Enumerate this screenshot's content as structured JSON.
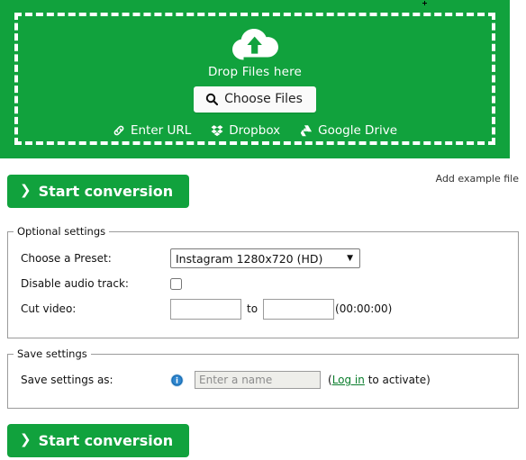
{
  "dropzone": {
    "cloud_icon": "cloud-upload-icon",
    "drop_text": "Drop Files here",
    "choose_files_label": "Choose Files",
    "choose_files_icon": "search-icon",
    "sources": [
      {
        "label": "Enter URL",
        "icon": "link-icon"
      },
      {
        "label": "Dropbox",
        "icon": "dropbox-icon"
      },
      {
        "label": "Google Drive",
        "icon": "google-drive-icon"
      }
    ],
    "background_color": "#11a23d",
    "border_color": "#ffffff"
  },
  "actions": {
    "start_conversion_top": "Start conversion",
    "start_conversion_bottom": "Start conversion",
    "chevron": "❯",
    "add_example_file": "Add example file",
    "button_color": "#11a23d"
  },
  "optional_settings": {
    "legend": "Optional settings",
    "preset": {
      "label": "Choose a Preset:",
      "value": "Instagram 1280x720 (HD)",
      "options": [
        "Instagram 1280x720 (HD)"
      ],
      "arrow_icon": "chevron-down-icon"
    },
    "disable_audio": {
      "label": "Disable audio track:",
      "checked": false
    },
    "cut_video": {
      "label": "Cut video:",
      "from_value": "",
      "to_word": "to",
      "to_value": "",
      "hint": "(00:00:00)"
    }
  },
  "save_settings": {
    "legend": "Save settings",
    "label": "Save settings as:",
    "info_icon": "info-icon",
    "name_placeholder": "Enter a name",
    "name_value": "",
    "note_prefix": "(",
    "login_link": "Log in",
    "note_suffix": " to activate)"
  }
}
